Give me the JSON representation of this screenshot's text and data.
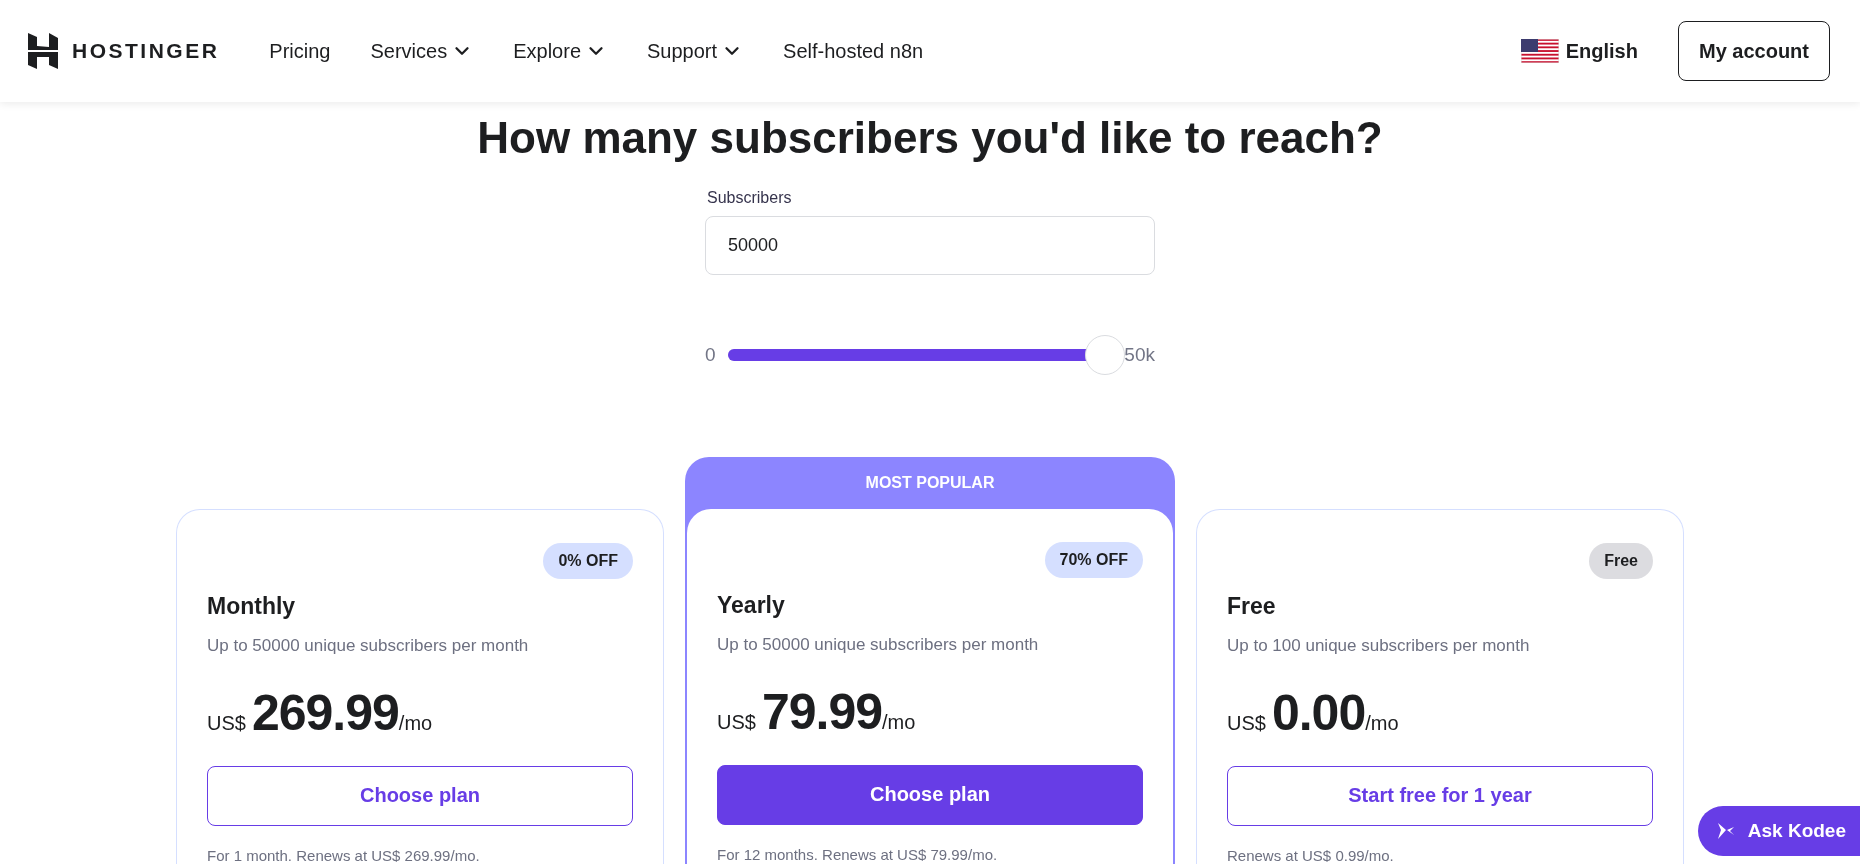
{
  "header": {
    "logo": "HOSTINGER",
    "nav": [
      {
        "label": "Pricing",
        "has_menu": false
      },
      {
        "label": "Services",
        "has_menu": true
      },
      {
        "label": "Explore",
        "has_menu": true
      },
      {
        "label": "Support",
        "has_menu": true
      },
      {
        "label": "Self-hosted n8n",
        "has_menu": false
      }
    ],
    "language": "English",
    "account_button": "My account"
  },
  "heading": "How many subscribers you'd like to reach?",
  "subscribers": {
    "label": "Subscribers",
    "value": "50000"
  },
  "slider": {
    "min_label": "0",
    "max_label": "50k",
    "level": 1
  },
  "plans": [
    {
      "name": "Monthly",
      "badge": {
        "text": "0% OFF",
        "color": "#d5dfff"
      },
      "popular": false,
      "description": "Up to 50000 unique subscribers per month",
      "currency": "US$",
      "price": "269.99",
      "period": "/mo",
      "button": "Choose plan",
      "primary": false,
      "note": "For 1 month. Renews at US$ 269.99/mo."
    },
    {
      "name": "Yearly",
      "badge": {
        "text": "70% OFF",
        "color": "#d5dfff"
      },
      "popular": true,
      "ribbon": "MOST POPULAR",
      "description": "Up to 50000 unique subscribers per month",
      "currency": "US$",
      "price": "79.99",
      "period": "/mo",
      "button": "Choose plan",
      "primary": true,
      "note": "For 12 months. Renews at US$ 79.99/mo."
    },
    {
      "name": "Free",
      "badge": {
        "text": "Free",
        "color": "#dcdce0"
      },
      "popular": false,
      "description": "Up to 100 unique subscribers per month",
      "currency": "US$",
      "price": "0.00",
      "period": "/mo",
      "button": "Start free for 1 year",
      "primary": false,
      "note": "Renews at US$ 0.99/mo."
    }
  ],
  "chat_button": "Ask Kodee"
}
